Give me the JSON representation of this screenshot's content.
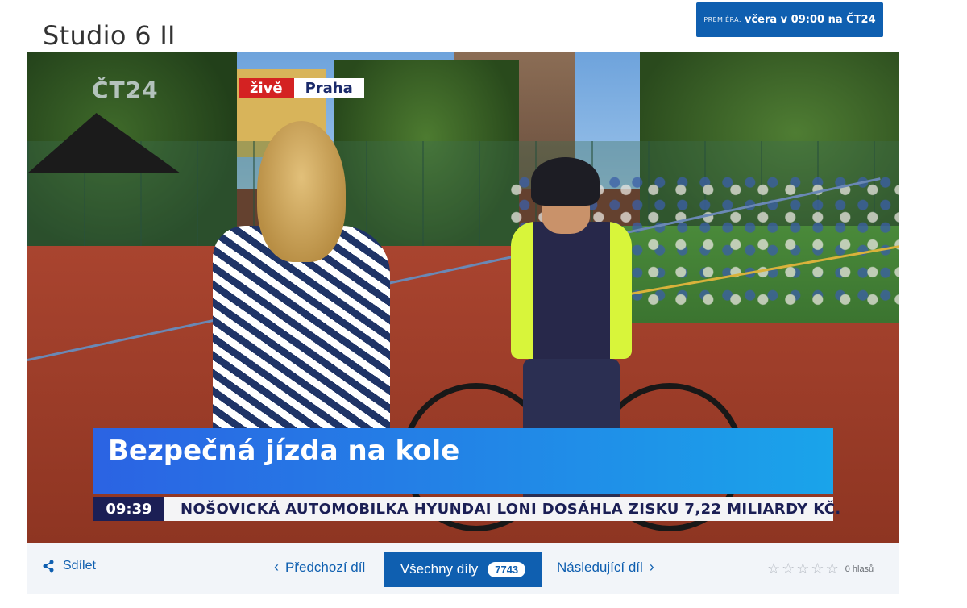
{
  "page": {
    "title": "Studio 6 II"
  },
  "premiere": {
    "label": "PREMIÉRA:",
    "value": "včera v 09:00 na ČT24"
  },
  "video": {
    "channel_logo": "ČT24",
    "live_label": "živě",
    "location": "Praha",
    "caption": "Bezpečná jízda na kole",
    "ticker_time": "09:39",
    "ticker_news": "NOŠOVICKÁ AUTOMOBILKA HYUNDAI LONI DOSÁHLA ZISKU 7,22 MILIARDY KČ."
  },
  "controls": {
    "share_label": "Sdílet",
    "prev_label": "Předchozí díl",
    "all_label": "Všechny díly",
    "all_count": "7743",
    "next_label": "Následující díl",
    "rating": {
      "max": 5,
      "value": 0,
      "votes_label": "0 hlasů"
    }
  },
  "icons": {
    "share": "share-icon",
    "prev": "chevron-left-icon",
    "next": "chevron-right-icon",
    "star": "star-outline-icon"
  },
  "colors": {
    "brand_blue": "#0f5fb0",
    "live_red": "#d42222",
    "caption_blue": "#2b63e3",
    "ticker_navy": "#1b1f55"
  }
}
